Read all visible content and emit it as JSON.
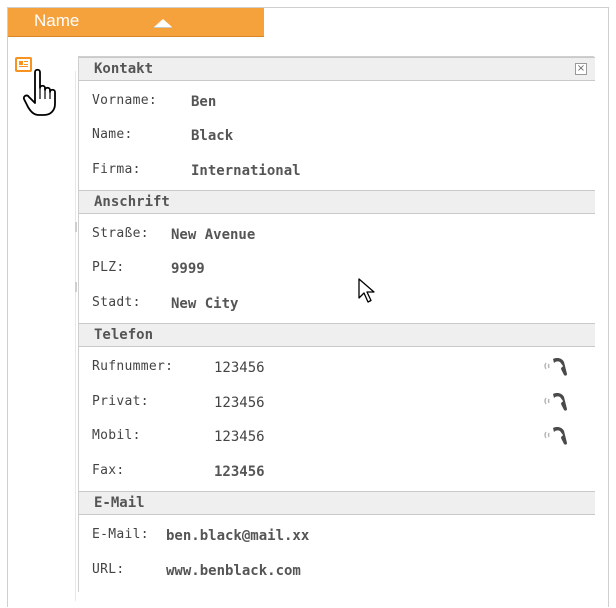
{
  "table": {
    "column_header": "Name"
  },
  "popup": {
    "sections": [
      {
        "title": "Kontakt",
        "rows": [
          {
            "label": "Vorname:",
            "value": "Ben"
          },
          {
            "label": "Name:",
            "value": "Black"
          },
          {
            "label": "Firma:",
            "value": "International"
          }
        ]
      },
      {
        "title": "Anschrift",
        "rows": [
          {
            "label": "Straße:",
            "value": "New Avenue"
          },
          {
            "label": "PLZ:",
            "value": "9999"
          },
          {
            "label": "Stadt:",
            "value": "New City"
          }
        ]
      },
      {
        "title": "Telefon",
        "rows": [
          {
            "label": "Rufnummer:",
            "value": "123456",
            "icon": "phone-call-icon"
          },
          {
            "label": "Privat:",
            "value": "123456",
            "icon": "phone-call-icon"
          },
          {
            "label": "Mobil:",
            "value": "123456",
            "icon": "phone-call-icon"
          },
          {
            "label": "Fax:",
            "value": "123456"
          }
        ]
      },
      {
        "title": "E-Mail",
        "rows": [
          {
            "label": "E-Mail:",
            "value": "ben.black@mail.xx"
          },
          {
            "label": "URL:",
            "value": "www.benblack.com"
          }
        ]
      }
    ],
    "close_label": "×"
  },
  "colors": {
    "header_orange": "#f5a13c",
    "section_bg": "#efefef",
    "text": "#555555"
  }
}
